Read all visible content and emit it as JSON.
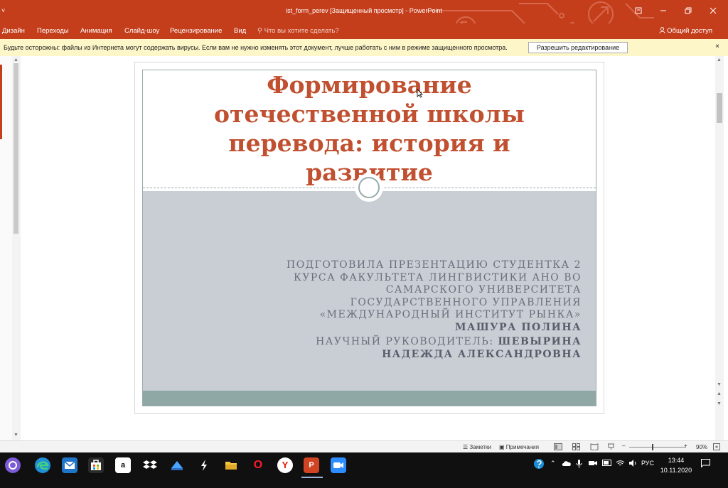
{
  "window": {
    "title": "ist_form_perev [Защищенный просмотр] - PowerPoint",
    "quick_access": "˅"
  },
  "ribbon": {
    "tabs": [
      "Дизайн",
      "Переходы",
      "Анимация",
      "Слайд-шоу",
      "Рецензирование",
      "Вид"
    ],
    "tell_me": "Что вы хотите сделать?",
    "share": "Общий доступ"
  },
  "protected_view": {
    "message": "Будьте осторожны: файлы из Интернета могут содержать вирусы. Если вам не нужно изменять этот документ, лучше работать с ним в режиме защищенного просмотра.",
    "enable_button": "Разрешить редактирование",
    "close": "×"
  },
  "slide": {
    "title_lines": [
      "Формирование",
      "отечественной школы",
      "перевода: история и",
      "развитие"
    ],
    "subtitle_lines": [
      "ПОДГОТОВИЛА ПРЕЗЕНТАЦИЮ СТУДЕНТКА 2",
      "КУРСА ФАКУЛЬТЕТА ЛИНГВИСТИКИ АНО ВО",
      "САМАРСКОГО УНИВЕРСИТЕТА",
      "ГОСУДАРСТВЕННОГО УПРАВЛЕНИЯ",
      "«МЕЖДУНАРОДНЫЙ ИНСТИТУТ РЫНКА»"
    ],
    "author": "МАШУРА ПОЛИНА",
    "supervisor_label": "НАУЧНЫЙ РУКОВОДИТЕЛЬ:",
    "supervisor_name_1": "ШЕВЫРИНА",
    "supervisor_name_2": "НАДЕЖДА АЛЕКСАНДРОВНА",
    "colors": {
      "title": "#c0502f",
      "body_bg": "#c8ced3",
      "footer": "#8fa8a5"
    }
  },
  "statusbar": {
    "notes": "Заметки",
    "comments": "Примечания",
    "zoom_minus": "–",
    "zoom_plus": "+",
    "zoom": "90%"
  },
  "taskbar": {
    "apps": [
      "cortana",
      "edge",
      "mail",
      "store",
      "amazon",
      "dropbox",
      "app-green",
      "app-arrow",
      "file-explorer",
      "opera",
      "yandex",
      "powerpoint",
      "zoom"
    ],
    "amazon_glyph": "a",
    "yandex_glyph": "Y",
    "opera_glyph": "O",
    "ppt_glyph": "P",
    "language": "РУС",
    "time": "13:44",
    "date": "10.11.2020"
  },
  "theme": {
    "accent": "#c43e1c",
    "message_bar": "#fdf6c8"
  }
}
